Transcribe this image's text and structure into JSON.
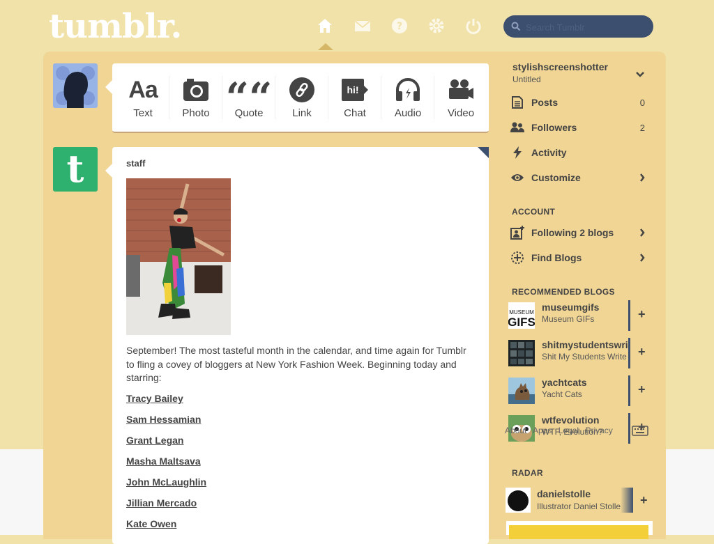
{
  "header": {
    "logo_text": "tumblr.",
    "nav": [
      {
        "name": "home-icon",
        "icon": "house"
      },
      {
        "name": "mail-icon",
        "icon": "envelope"
      },
      {
        "name": "help-icon",
        "icon": "question"
      },
      {
        "name": "gear-icon",
        "icon": "gear"
      },
      {
        "name": "power-icon",
        "icon": "power"
      }
    ],
    "search_placeholder": "Search Tumblr"
  },
  "composer": {
    "types": [
      {
        "label": "Text",
        "icon_text": "Aa"
      },
      {
        "label": "Photo",
        "icon": "camera"
      },
      {
        "label": "Quote",
        "icon_text": "““"
      },
      {
        "label": "Link",
        "icon": "link"
      },
      {
        "label": "Chat",
        "icon_text": "hi!"
      },
      {
        "label": "Audio",
        "icon": "headphones"
      },
      {
        "label": "Video",
        "icon": "video-camera"
      }
    ]
  },
  "post": {
    "blog": "staff",
    "avatar_letter": "t",
    "text": "September! The most tasteful month in the calendar, and time again for Tumblr to fling a covey of bloggers at New York Fashion Week. Beginning today and starring:",
    "links": [
      "Tracy Bailey",
      "Sam Hessamian",
      "Grant Legan",
      "Masha Maltsava",
      "John McLaughlin",
      "Jillian Mercado",
      "Kate Owen"
    ]
  },
  "sidebar": {
    "username": "stylishscreenshotter",
    "blog_title": "Untitled",
    "items": [
      {
        "label": "Posts",
        "count": "0",
        "icon": "posts"
      },
      {
        "label": "Followers",
        "count": "2",
        "icon": "followers"
      },
      {
        "label": "Activity",
        "icon": "bolt"
      },
      {
        "label": "Customize",
        "icon": "eye"
      }
    ],
    "account_heading": "ACCOUNT",
    "account_items": [
      {
        "label": "Following 2 blogs",
        "icon": "add-person"
      },
      {
        "label": "Find Blogs",
        "icon": "compass"
      }
    ],
    "recommended_heading": "RECOMMENDED BLOGS",
    "recommended": [
      {
        "name": "museumgifs",
        "title": "Museum GIFs",
        "thumb_text": "MUSEUM GIFS"
      },
      {
        "name": "shitmystudentswrite",
        "title": "Shit My Students Write"
      },
      {
        "name": "yachtcats",
        "title": "Yacht Cats"
      },
      {
        "name": "wtfevolution",
        "title": "WTF, Evolution?"
      }
    ],
    "follow_symbol": "+",
    "footer_links": [
      "About",
      "Apps",
      "Legal",
      "Privacy"
    ],
    "radar_heading": "RADAR",
    "radar": {
      "name": "danielstolle",
      "title": "Illustrator Daniel Stolle"
    }
  },
  "colors": {
    "background": "#f1e2a9",
    "accent": "#3d4f6f",
    "staff_green": "#2eb06e"
  }
}
